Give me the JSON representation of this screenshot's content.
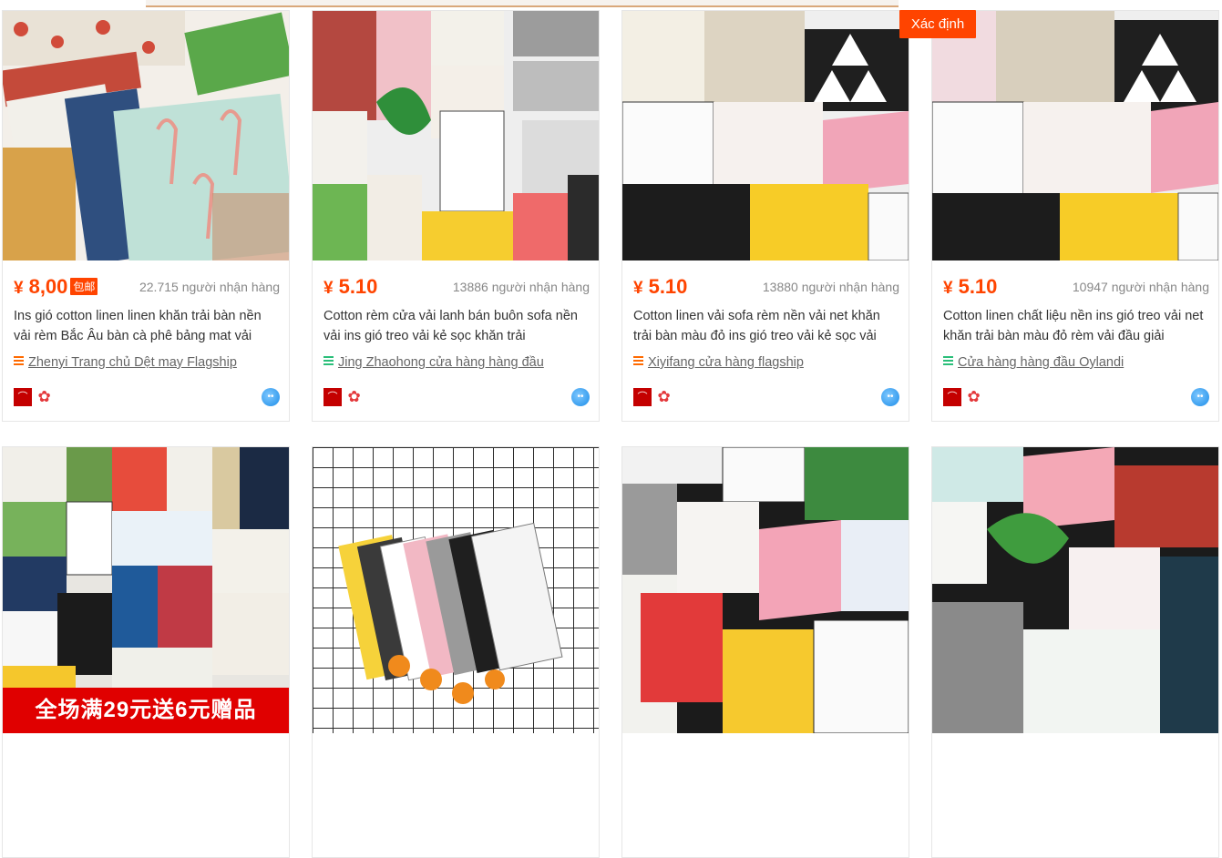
{
  "confirm_button": "Xác định",
  "products": [
    {
      "yen": "¥",
      "price": "8,00",
      "badge": "包邮",
      "buyers": "22.715 người nhận hàng",
      "title": "Ins gió cotton linen linen khăn trải bàn nền vải rèm Bắc Âu bàn cà phê bảng mat vải",
      "shop": "Zhenyi Trang chủ Dệt may Flagship",
      "shop_icon_color": "#ff6a00"
    },
    {
      "yen": "¥",
      "price": "5.10",
      "buyers": "13886 người nhận hàng",
      "title": "Cotton rèm cửa vải lanh bán buôn sofa nền vải ins gió treo vải kẻ sọc khăn trải",
      "shop": "Jing Zhaohong cửa hàng hàng đầu",
      "shop_icon_color": "#2bbf7a"
    },
    {
      "yen": "¥",
      "price": "5.10",
      "buyers": "13880 người nhận hàng",
      "title": "Cotton linen vải sofa rèm nền vải net khăn trải bàn màu đỏ ins gió treo vải kẻ sọc vải",
      "shop": "Xiyifang cửa hàng flagship",
      "shop_icon_color": "#ff6a00"
    },
    {
      "yen": "¥",
      "price": "5.10",
      "buyers": "10947 người nhận hàng",
      "title": "Cotton linen chất liệu nền ins gió treo vải net khăn trải bàn màu đỏ rèm vải đầu giải",
      "shop": "Cửa hàng hàng đầu Oylandi",
      "shop_icon_color": "#2bbf7a"
    }
  ],
  "promo_banner": "全场满29元送6元赠品",
  "icons": {
    "tmall": "tmall-badge-icon",
    "flower": "flower-badge-icon",
    "wangwang": "wangwang-chat-icon"
  },
  "colors": {
    "accent": "#ff4400",
    "banner": "#e00000"
  }
}
